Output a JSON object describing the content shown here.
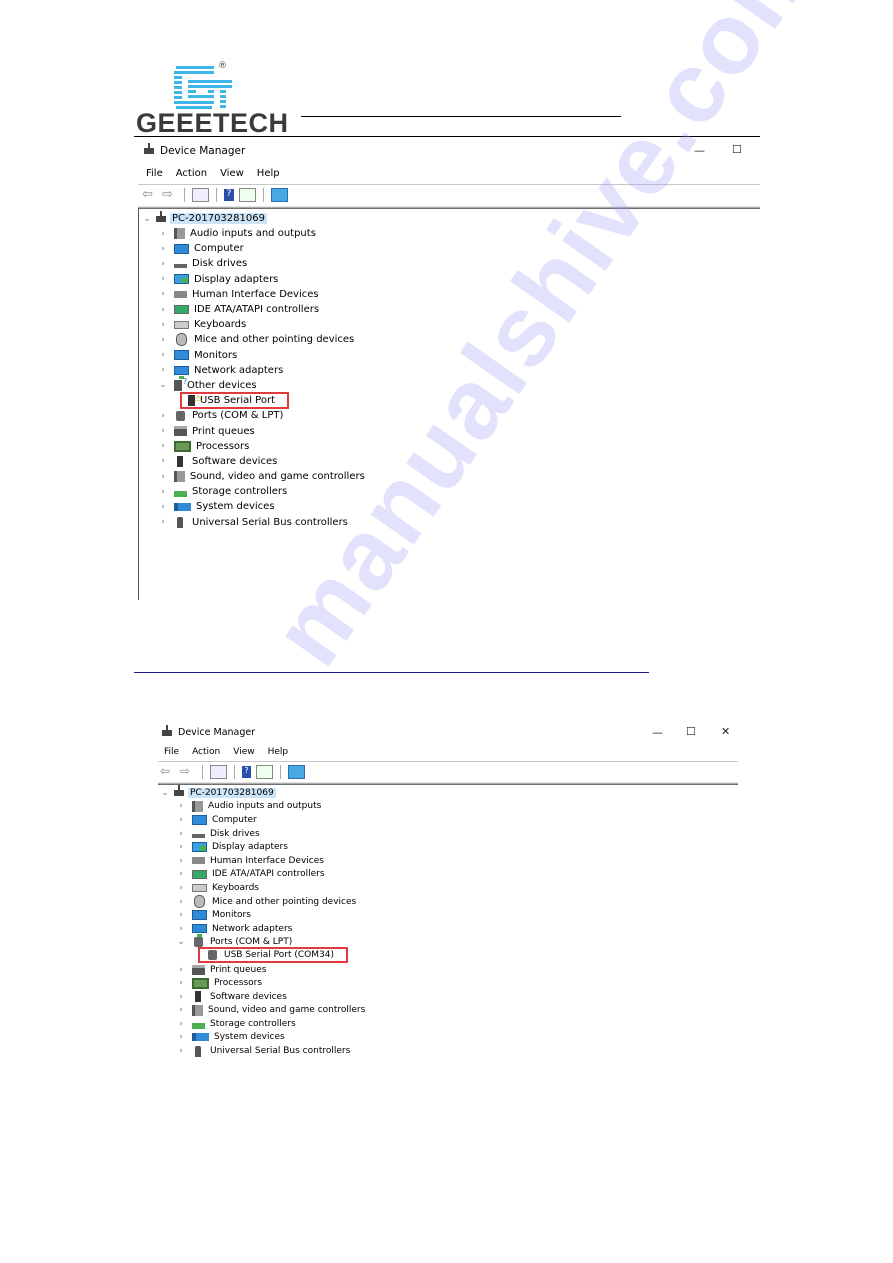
{
  "header": {
    "brand": "GEEETECH",
    "registered_mark": "®"
  },
  "watermark": "manualshive.com",
  "window1": {
    "title": "Device Manager",
    "controls": {
      "minimize": "—",
      "maximize": "☐"
    },
    "menu": [
      "File",
      "Action",
      "View",
      "Help"
    ],
    "toolbar_icons": [
      "back-icon",
      "forward-icon",
      "properties-icon",
      "help-icon",
      "update-driver-icon",
      "scan-hardware-icon"
    ],
    "root": "PC-201703281069",
    "tree": [
      {
        "label": "Audio inputs and outputs",
        "icon": "audio",
        "expanded": false
      },
      {
        "label": "Computer",
        "icon": "monitor",
        "expanded": false
      },
      {
        "label": "Disk drives",
        "icon": "disk",
        "expanded": false
      },
      {
        "label": "Display adapters",
        "icon": "display",
        "expanded": false
      },
      {
        "label": "Human Interface Devices",
        "icon": "hid",
        "expanded": false
      },
      {
        "label": "IDE ATA/ATAPI controllers",
        "icon": "ide",
        "expanded": false
      },
      {
        "label": "Keyboards",
        "icon": "kbd",
        "expanded": false
      },
      {
        "label": "Mice and other pointing devices",
        "icon": "mouse",
        "expanded": false
      },
      {
        "label": "Monitors",
        "icon": "monitor",
        "expanded": false
      },
      {
        "label": "Network adapters",
        "icon": "net",
        "expanded": false
      },
      {
        "label": "Other devices",
        "icon": "other",
        "expanded": true,
        "children": [
          {
            "label": "USB Serial Port",
            "icon": "warn",
            "highlighted": true
          }
        ]
      },
      {
        "label": "Ports (COM & LPT)",
        "icon": "ports",
        "expanded": false
      },
      {
        "label": "Print queues",
        "icon": "print",
        "expanded": false
      },
      {
        "label": "Processors",
        "icon": "cpu",
        "expanded": false
      },
      {
        "label": "Software devices",
        "icon": "soft",
        "expanded": false
      },
      {
        "label": "Sound, video and game controllers",
        "icon": "audio",
        "expanded": false
      },
      {
        "label": "Storage controllers",
        "icon": "storage",
        "expanded": false
      },
      {
        "label": "System devices",
        "icon": "sys",
        "expanded": false
      },
      {
        "label": "Universal Serial Bus controllers",
        "icon": "usb",
        "expanded": false
      }
    ]
  },
  "window2": {
    "title": "Device Manager",
    "controls": {
      "minimize": "—",
      "maximize": "☐",
      "close": "✕"
    },
    "menu": [
      "File",
      "Action",
      "View",
      "Help"
    ],
    "toolbar_icons": [
      "back-icon",
      "forward-icon",
      "properties-icon",
      "help-icon",
      "update-driver-icon",
      "scan-hardware-icon"
    ],
    "root": "PC-201703281069",
    "tree": [
      {
        "label": "Audio inputs and outputs",
        "icon": "audio",
        "expanded": false
      },
      {
        "label": "Computer",
        "icon": "monitor",
        "expanded": false
      },
      {
        "label": "Disk drives",
        "icon": "disk",
        "expanded": false
      },
      {
        "label": "Display adapters",
        "icon": "display",
        "expanded": false
      },
      {
        "label": "Human Interface Devices",
        "icon": "hid",
        "expanded": false
      },
      {
        "label": "IDE ATA/ATAPI controllers",
        "icon": "ide",
        "expanded": false
      },
      {
        "label": "Keyboards",
        "icon": "kbd",
        "expanded": false
      },
      {
        "label": "Mice and other pointing devices",
        "icon": "mouse",
        "expanded": false
      },
      {
        "label": "Monitors",
        "icon": "monitor",
        "expanded": false
      },
      {
        "label": "Network adapters",
        "icon": "net",
        "expanded": false
      },
      {
        "label": "Ports (COM & LPT)",
        "icon": "ports",
        "expanded": true,
        "children": [
          {
            "label": "USB Serial Port (COM34)",
            "icon": "ports",
            "highlighted": true
          }
        ]
      },
      {
        "label": "Print queues",
        "icon": "print",
        "expanded": false
      },
      {
        "label": "Processors",
        "icon": "cpu",
        "expanded": false
      },
      {
        "label": "Software devices",
        "icon": "soft",
        "expanded": false
      },
      {
        "label": "Sound, video and game controllers",
        "icon": "audio",
        "expanded": false
      },
      {
        "label": "Storage controllers",
        "icon": "storage",
        "expanded": false
      },
      {
        "label": "System devices",
        "icon": "sys",
        "expanded": false
      },
      {
        "label": "Universal Serial Bus controllers",
        "icon": "usb",
        "expanded": false
      }
    ]
  },
  "colors": {
    "highlight_box": "#e03a3e",
    "root_selection": "#cce4f7",
    "logo_blue": "#3fb6e8",
    "link_rule": "#1a1a8c"
  }
}
